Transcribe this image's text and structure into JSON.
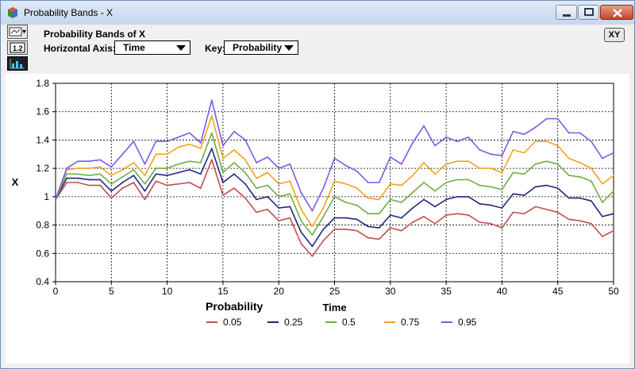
{
  "window": {
    "title": "Probability Bands - X",
    "controls": {
      "minimize": "minimize",
      "maximize": "maximize",
      "close": "close"
    }
  },
  "toolbar": {
    "panel_title": "Probability Bands of X",
    "horizontal_axis_label": "Horizontal Axis:",
    "horizontal_axis_value": "Time",
    "key_label": "Key:",
    "key_value": "Probability",
    "xy_button": "XY",
    "side_buttons": [
      "graph-view-icon",
      "table-view-icon",
      "bar-chart-icon"
    ]
  },
  "chart_data": {
    "type": "line",
    "xlabel": "Time",
    "ylabel": "X",
    "xlim": [
      0,
      50
    ],
    "ylim": [
      0.4,
      1.8
    ],
    "xticks": [
      0,
      5,
      10,
      15,
      20,
      25,
      30,
      35,
      40,
      45,
      50
    ],
    "yticks": [
      0.4,
      0.6,
      0.8,
      1,
      1.2,
      1.4,
      1.6,
      1.8
    ],
    "ytick_labels": [
      "0.4",
      "0.6",
      "0.8",
      "1",
      "1.2",
      "1.4",
      "1.6",
      "1.8"
    ],
    "grid": true,
    "legend_title": "Probability",
    "legend_position": "bottom",
    "x": [
      0,
      1,
      2,
      3,
      4,
      5,
      6,
      7,
      8,
      9,
      10,
      11,
      12,
      13,
      14,
      15,
      16,
      17,
      18,
      19,
      20,
      21,
      22,
      23,
      24,
      25,
      26,
      27,
      28,
      29,
      30,
      31,
      32,
      33,
      34,
      35,
      36,
      37,
      38,
      39,
      40,
      41,
      42,
      43,
      44,
      45,
      46,
      47,
      48,
      49,
      50
    ],
    "series": [
      {
        "name": "0.05",
        "color": "#c0504d",
        "values": [
          0.98,
          1.1,
          1.1,
          1.08,
          1.08,
          0.99,
          1.06,
          1.1,
          0.98,
          1.11,
          1.08,
          1.09,
          1.1,
          1.06,
          1.26,
          1.01,
          1.06,
          0.99,
          0.89,
          0.91,
          0.83,
          0.85,
          0.67,
          0.58,
          0.69,
          0.77,
          0.77,
          0.76,
          0.71,
          0.7,
          0.78,
          0.76,
          0.82,
          0.86,
          0.81,
          0.87,
          0.88,
          0.87,
          0.82,
          0.81,
          0.78,
          0.89,
          0.88,
          0.93,
          0.91,
          0.89,
          0.84,
          0.83,
          0.81,
          0.72,
          0.76
        ]
      },
      {
        "name": "0.25",
        "color": "#1f2a7c",
        "values": [
          0.98,
          1.13,
          1.13,
          1.12,
          1.12,
          1.04,
          1.1,
          1.15,
          1.04,
          1.16,
          1.15,
          1.17,
          1.19,
          1.16,
          1.34,
          1.1,
          1.16,
          1.09,
          0.98,
          1.0,
          0.92,
          0.93,
          0.75,
          0.65,
          0.77,
          0.85,
          0.85,
          0.84,
          0.79,
          0.78,
          0.87,
          0.85,
          0.92,
          0.98,
          0.93,
          0.98,
          1.0,
          1.0,
          0.95,
          0.94,
          0.92,
          1.02,
          1.01,
          1.07,
          1.08,
          1.06,
          0.99,
          0.99,
          0.97,
          0.86,
          0.88
        ]
      },
      {
        "name": "0.5",
        "color": "#70ad47",
        "values": [
          0.98,
          1.16,
          1.16,
          1.15,
          1.16,
          1.09,
          1.14,
          1.19,
          1.09,
          1.2,
          1.2,
          1.23,
          1.25,
          1.24,
          1.45,
          1.17,
          1.24,
          1.17,
          1.06,
          1.08,
          1.0,
          1.02,
          0.83,
          0.73,
          0.86,
          1.0,
          0.96,
          0.94,
          0.88,
          0.88,
          0.98,
          0.96,
          1.03,
          1.1,
          1.04,
          1.1,
          1.12,
          1.12,
          1.08,
          1.07,
          1.05,
          1.17,
          1.16,
          1.23,
          1.25,
          1.23,
          1.15,
          1.14,
          1.11,
          0.96,
          1.04
        ]
      },
      {
        "name": "0.75",
        "color": "#f4a31c",
        "values": [
          0.98,
          1.19,
          1.2,
          1.2,
          1.21,
          1.15,
          1.19,
          1.24,
          1.15,
          1.3,
          1.3,
          1.35,
          1.37,
          1.34,
          1.57,
          1.27,
          1.33,
          1.26,
          1.13,
          1.17,
          1.09,
          1.11,
          0.91,
          0.79,
          0.92,
          1.11,
          1.09,
          1.06,
          0.99,
          0.98,
          1.09,
          1.08,
          1.15,
          1.24,
          1.16,
          1.23,
          1.25,
          1.25,
          1.2,
          1.2,
          1.17,
          1.33,
          1.31,
          1.39,
          1.39,
          1.36,
          1.27,
          1.24,
          1.2,
          1.09,
          1.15
        ]
      },
      {
        "name": "0.95",
        "color": "#7a5ce6",
        "values": [
          0.98,
          1.2,
          1.25,
          1.25,
          1.26,
          1.21,
          1.3,
          1.39,
          1.23,
          1.39,
          1.39,
          1.42,
          1.45,
          1.38,
          1.68,
          1.36,
          1.46,
          1.4,
          1.24,
          1.28,
          1.2,
          1.23,
          1.03,
          0.9,
          1.06,
          1.27,
          1.22,
          1.18,
          1.1,
          1.1,
          1.28,
          1.23,
          1.38,
          1.5,
          1.36,
          1.42,
          1.39,
          1.42,
          1.33,
          1.3,
          1.29,
          1.46,
          1.44,
          1.49,
          1.55,
          1.55,
          1.45,
          1.45,
          1.39,
          1.27,
          1.31
        ]
      }
    ]
  }
}
